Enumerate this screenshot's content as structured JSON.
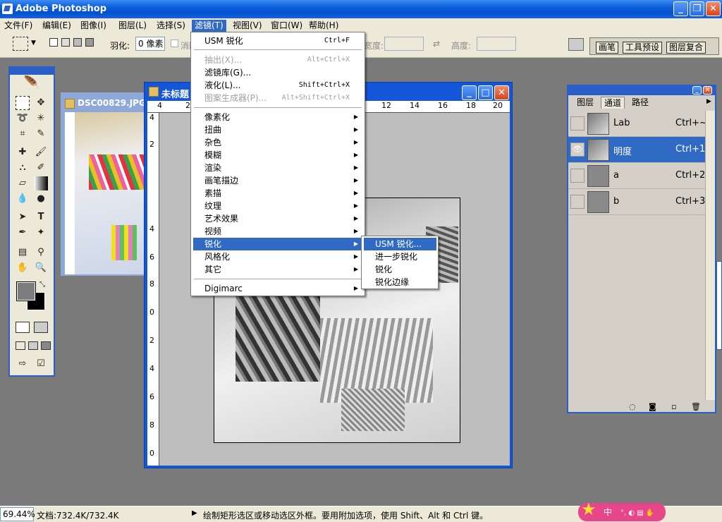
{
  "app": {
    "title": "Adobe Photoshop"
  },
  "menubar": [
    {
      "label": "文件(F)"
    },
    {
      "label": "编辑(E)"
    },
    {
      "label": "图像(I)"
    },
    {
      "label": "图层(L)"
    },
    {
      "label": "选择(S)"
    },
    {
      "label": "滤镜(T)"
    },
    {
      "label": "视图(V)"
    },
    {
      "label": "窗口(W)"
    },
    {
      "label": "帮助(H)"
    }
  ],
  "options": {
    "feather_label": "羽化:",
    "feather_value": "0 像素",
    "antialias_label": "消除",
    "width_label": "宽度:",
    "height_label": "高度:"
  },
  "palette_well": {
    "tabs": [
      "画笔",
      "工具预设",
      "图层复合"
    ]
  },
  "doc1": {
    "title": "DSC00829.JPG"
  },
  "doc2": {
    "title": "未标题",
    "ruler_h": [
      "4",
      "2",
      "12",
      "14",
      "16",
      "18",
      "20"
    ],
    "ruler_v": [
      "4",
      "2",
      "4",
      "6",
      "8",
      "0",
      "2",
      "4",
      "6",
      "8",
      "0"
    ]
  },
  "filter_menu": {
    "items": [
      {
        "label": "USM 锐化",
        "shortcut": "Ctrl+F",
        "disabled": false
      },
      {
        "label": "抽出(X)...",
        "shortcut": "Alt+Ctrl+X",
        "disabled": true
      },
      {
        "label": "滤镜库(G)...",
        "shortcut": "",
        "disabled": false
      },
      {
        "label": "液化(L)...",
        "shortcut": "Shift+Ctrl+X",
        "disabled": false
      },
      {
        "label": "图案生成器(P)...",
        "shortcut": "Alt+Shift+Ctrl+X",
        "disabled": true
      },
      {
        "label": "像素化"
      },
      {
        "label": "扭曲"
      },
      {
        "label": "杂色"
      },
      {
        "label": "模糊"
      },
      {
        "label": "渲染"
      },
      {
        "label": "画笔描边"
      },
      {
        "label": "素描"
      },
      {
        "label": "纹理"
      },
      {
        "label": "艺术效果"
      },
      {
        "label": "视频"
      },
      {
        "label": "锐化"
      },
      {
        "label": "风格化"
      },
      {
        "label": "其它"
      },
      {
        "label": "Digimarc"
      }
    ],
    "highlighted": "锐化"
  },
  "sharpen_submenu": {
    "items": [
      "USM 锐化...",
      "进一步锐化",
      "锐化",
      "锐化边缘"
    ],
    "highlighted": "USM 锐化..."
  },
  "channels_panel": {
    "tabs": [
      "图层",
      "通道",
      "路径"
    ],
    "channels": [
      {
        "name": "Lab",
        "shortcut": "Ctrl+~",
        "visible": false,
        "selected": false
      },
      {
        "name": "明度",
        "shortcut": "Ctrl+1",
        "visible": true,
        "selected": true
      },
      {
        "name": "a",
        "shortcut": "Ctrl+2",
        "visible": false,
        "selected": false
      },
      {
        "name": "b",
        "shortcut": "Ctrl+3",
        "visible": false,
        "selected": false
      }
    ]
  },
  "status": {
    "zoom": "69.44%",
    "doc_size": "文档:732.4K/732.4K",
    "hint": "绘制矩形选区或移动选区外框。要用附加选项，使用 Shift、Alt 和 Ctrl 键。"
  },
  "ime": {
    "label": "中"
  },
  "colors": {
    "titlebar": "#0a5fd8",
    "menu_highlight": "#316ac5",
    "background": "#7a7a7a"
  }
}
